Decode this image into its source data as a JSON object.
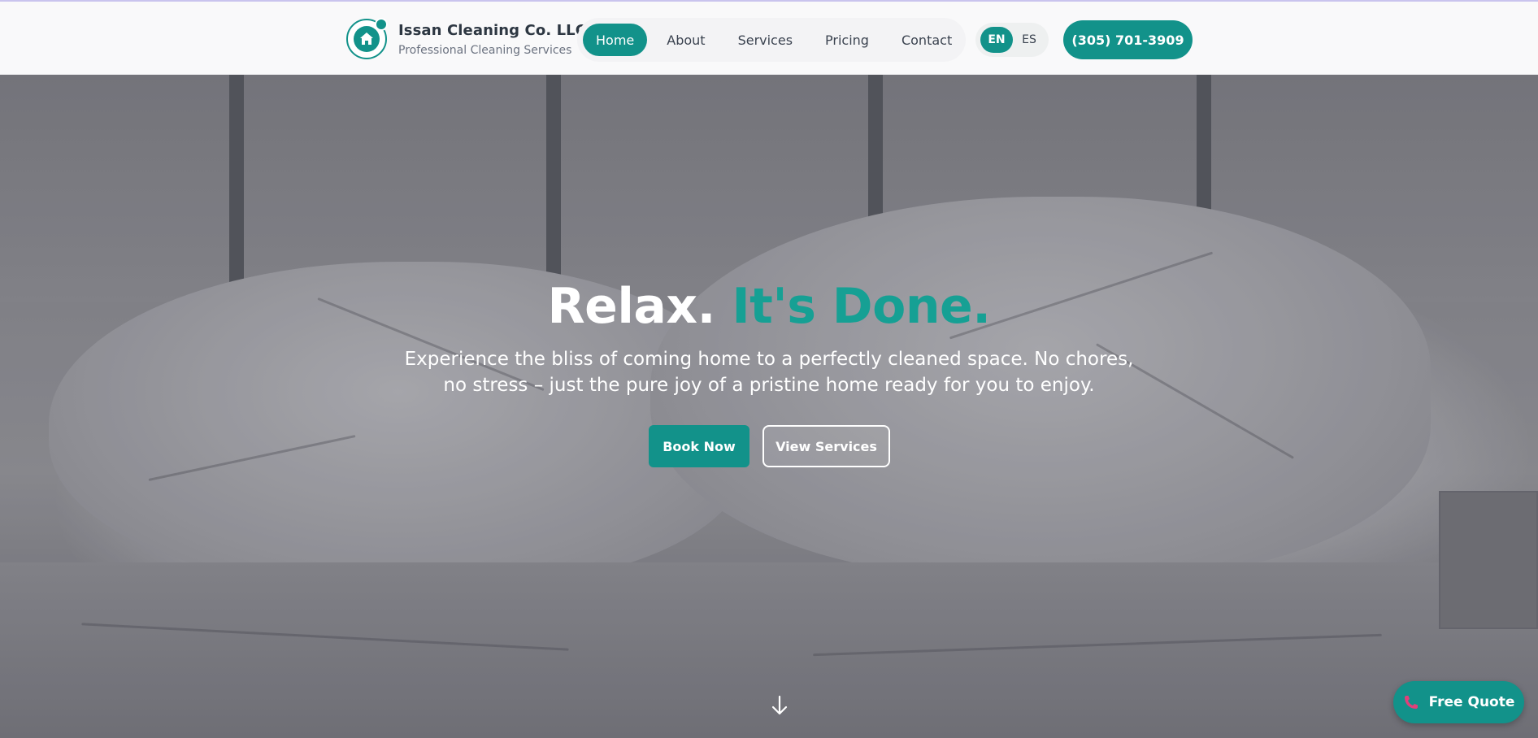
{
  "brand": {
    "name": "Issan Cleaning Co. LLC",
    "tagline": "Professional Cleaning Services"
  },
  "nav": {
    "items": [
      {
        "label": "Home",
        "active": true
      },
      {
        "label": "About",
        "active": false
      },
      {
        "label": "Services",
        "active": false
      },
      {
        "label": "Pricing",
        "active": false
      },
      {
        "label": "Contact",
        "active": false
      }
    ]
  },
  "language": {
    "options": [
      "EN",
      "ES"
    ],
    "selected": "EN"
  },
  "header": {
    "phone_label": "(305) 701-3909"
  },
  "hero": {
    "title_main": "Relax.",
    "title_accent": "It's Done.",
    "subtitle": "Experience the bliss of coming home to a perfectly cleaned space. No chores, no stress – just the pure joy of a pristine home ready for you to enjoy.",
    "primary_button": "Book Now",
    "secondary_button": "View Services",
    "scroll_icon": "arrow-down-icon"
  },
  "floating": {
    "quote_label": "Free Quote",
    "quote_icon": "phone-icon"
  },
  "colors": {
    "accent": "#12928a",
    "accent_text": "#16a094",
    "phone_icon": "#e0407a"
  }
}
